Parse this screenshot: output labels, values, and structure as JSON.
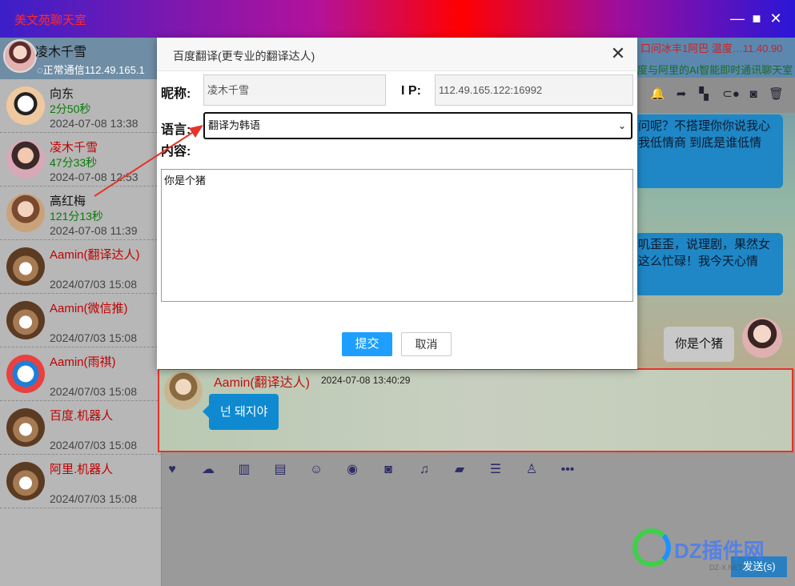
{
  "window": {
    "title": "美文苑聊天室",
    "min_icon": "minimize-icon",
    "max_icon": "maximize-icon",
    "close_icon": "close-icon"
  },
  "me": {
    "name": "凌木千雪",
    "status": "正常通信112.49.165.1"
  },
  "contacts": [
    {
      "name": "向东",
      "online": "2分50秒",
      "time": "2024-07-08 13:38",
      "name_color": "black"
    },
    {
      "name": "凌木千雪",
      "online": "47分33秒",
      "time": "2024-07-08 12:53",
      "name_color": "red"
    },
    {
      "name": "高红梅",
      "online": "121分13秒",
      "time": "2024-07-08 11:39",
      "name_color": "black"
    },
    {
      "name": "Aamin(翻译达人)",
      "online": "",
      "time": "2024/07/03 15:08",
      "name_color": "red"
    },
    {
      "name": "Aamin(微信推)",
      "online": "",
      "time": "2024/07/03 15:08",
      "name_color": "red"
    },
    {
      "name": "Aamin(雨祺)",
      "online": "",
      "time": "2024/07/03 15:08",
      "name_color": "red"
    },
    {
      "name": "百度.机器人",
      "online": "",
      "time": "2024/07/03 15:08",
      "name_color": "red"
    },
    {
      "name": "阿里.机器人",
      "online": "",
      "time": "2024/07/03 15:08",
      "name_color": "red"
    }
  ],
  "top_strip": {
    "line1": "口问冰丰1阿巴 温度…11.40.90",
    "line2": "度与阿里的AI智能即时通讯聊天室"
  },
  "chat": {
    "bubble1": "问呢？不搭理你你说我心\n我低情商 到底是谁低情",
    "bubble2": "叽歪歪，说理剧，果然女\n这么忙碌！我今天心情",
    "my_message": "你是个猪",
    "reply": {
      "name": "Aamin(翻译达人)",
      "time": "2024-07-08 13:40:29",
      "text": "넌 돼지야"
    }
  },
  "send_button": "发送(s)",
  "watermark": {
    "text": "DZ插件网",
    "sub": "DZ-X.NET"
  },
  "dialog": {
    "title": "百度翻译(更专业的翻译达人)",
    "nickname_label": "昵称:",
    "nickname_value": "凌木千雪",
    "ip_label": "I P:",
    "ip_value": "112.49.165.122:16992",
    "lang_label": "语言:",
    "lang_value": "翻译为韩语",
    "content_label": "内容:",
    "content_value": "你是个猪",
    "submit": "提交",
    "cancel": "取消"
  },
  "colors": {
    "accent": "#1e9fff",
    "highlight_border": "#e5332a",
    "bubble_blue": "#0f8ad0"
  }
}
